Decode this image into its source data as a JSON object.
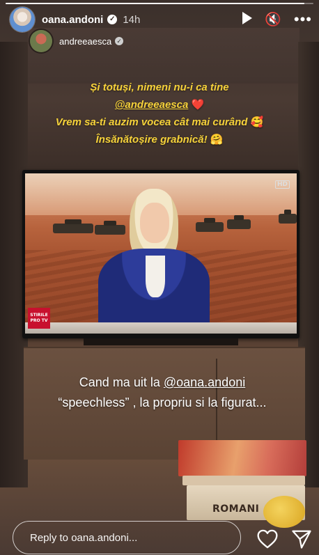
{
  "header": {
    "username": "oana.andoni",
    "time": "14h",
    "verified_icon": "verified-badge-icon",
    "play_icon": "play-icon",
    "mute_icon": "mute-icon",
    "more_icon": "more-icon",
    "more_label": "•••"
  },
  "progress": {
    "fraction": 0.97
  },
  "reshare": {
    "username": "andreeaesca"
  },
  "caption_top": {
    "line1": "Și totuși, nimeni nu-i ca tine",
    "mention": "@andreeaesca",
    "heart_emoji": "❤️",
    "line3": "Vrem sa-ti auzim vocea cât mai curând",
    "line3_emoji": "🥰",
    "line4": "Însănătoșire grabnică!",
    "line4_emoji": "🤗"
  },
  "tv": {
    "hd_badge": "HD",
    "logo_line1": "STIRILE",
    "logo_line2": "PRO TV"
  },
  "caption_mid": {
    "text_before": "Cand  ma uit la ",
    "mention": "@oana.andoni",
    "line2": "“speechless” ,  la propriu si la figurat..."
  },
  "decor": {
    "book_title": "ROMANI"
  },
  "reply": {
    "placeholder": "Reply to oana.andoni...",
    "like_icon": "heart-icon",
    "send_icon": "send-icon"
  }
}
